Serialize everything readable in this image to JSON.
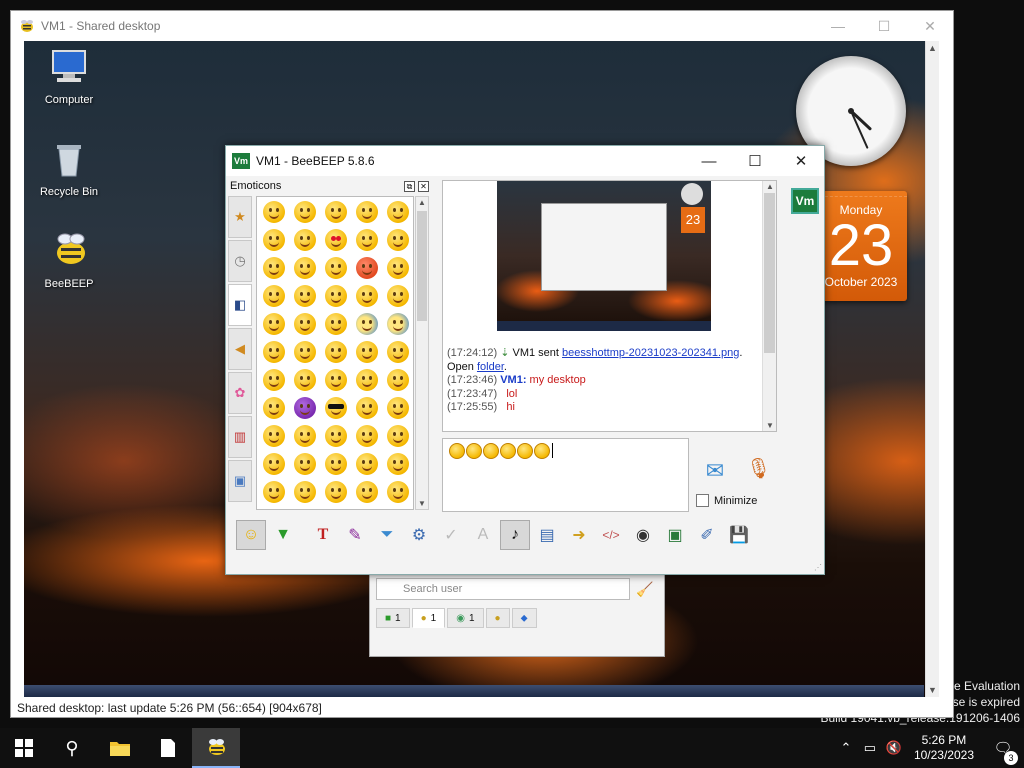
{
  "host": {
    "watermark": [
      "e Evaluation",
      "se is expired",
      "Build 19041.vb_release.191206-1406"
    ],
    "taskbar": {
      "items": [
        "start-icon",
        "search-icon",
        "file-explorer-icon",
        "notepad-icon",
        "beebeep-icon"
      ],
      "time": "5:26 PM",
      "date": "10/23/2023",
      "notifications": "3"
    }
  },
  "viewer": {
    "title": "VM1 - Shared desktop",
    "status": "Shared desktop: last update 5:26 PM (56::654) [904x678]"
  },
  "remote_desktop": {
    "icons": [
      {
        "label": "Computer",
        "icon": "computer-icon"
      },
      {
        "label": "Recycle Bin",
        "icon": "recycle-bin-icon"
      },
      {
        "label": "BeeBEEP",
        "icon": "beebeep-icon"
      }
    ],
    "calendar": {
      "weekday": "Monday",
      "day": "23",
      "month_year": "October 2023"
    },
    "clock": {
      "hour": 4,
      "minute": 26
    }
  },
  "chat_window": {
    "title": "VM1 - BeeBEEP 5.8.6",
    "emoticons_label": "Emoticons",
    "emoticon_categories": [
      "star-icon",
      "clock-icon",
      "people-icon",
      "bell-icon",
      "flower-icon",
      "building-icon",
      "symbols-icon"
    ],
    "log": [
      {
        "time": "(17:24:12)",
        "text": " VM1 sent ",
        "link": "beesshottmp-20231023-202341.png",
        "tail": "."
      },
      {
        "open_label": "Open ",
        "folder_label": "folder",
        "tail": "."
      },
      {
        "time": "(17:23:46)",
        "who": "VM1:",
        "msg": " my desktop"
      },
      {
        "time": "(17:23:47)",
        "msg": "lol"
      },
      {
        "time": "(17:25:55)",
        "msg": "hi"
      }
    ],
    "avatar_label": "Vm",
    "input_emoji_count": 6,
    "minimize_label": "Minimize",
    "toolbar": [
      "emoticons-icon",
      "bold-green-icon",
      "font-icon",
      "color-picker-icon",
      "filter-icon",
      "settings-icon",
      "spellcheck-icon",
      "word-complete-icon",
      "music-note-icon",
      "save-chat-icon",
      "send-file-icon",
      "code-icon",
      "screenshot-icon",
      "shared-desktop-icon",
      "edit-note-icon",
      "save-icon"
    ]
  },
  "main_window": {
    "search_placeholder": "Search user",
    "tabs": [
      {
        "icon": "users-icon",
        "count": "1"
      },
      {
        "icon": "group-icon",
        "count": "1"
      },
      {
        "icon": "chat-bubbles-icon",
        "count": "1"
      },
      {
        "icon": "people-icon",
        "count": ""
      },
      {
        "icon": "pin-icon",
        "count": ""
      }
    ]
  }
}
